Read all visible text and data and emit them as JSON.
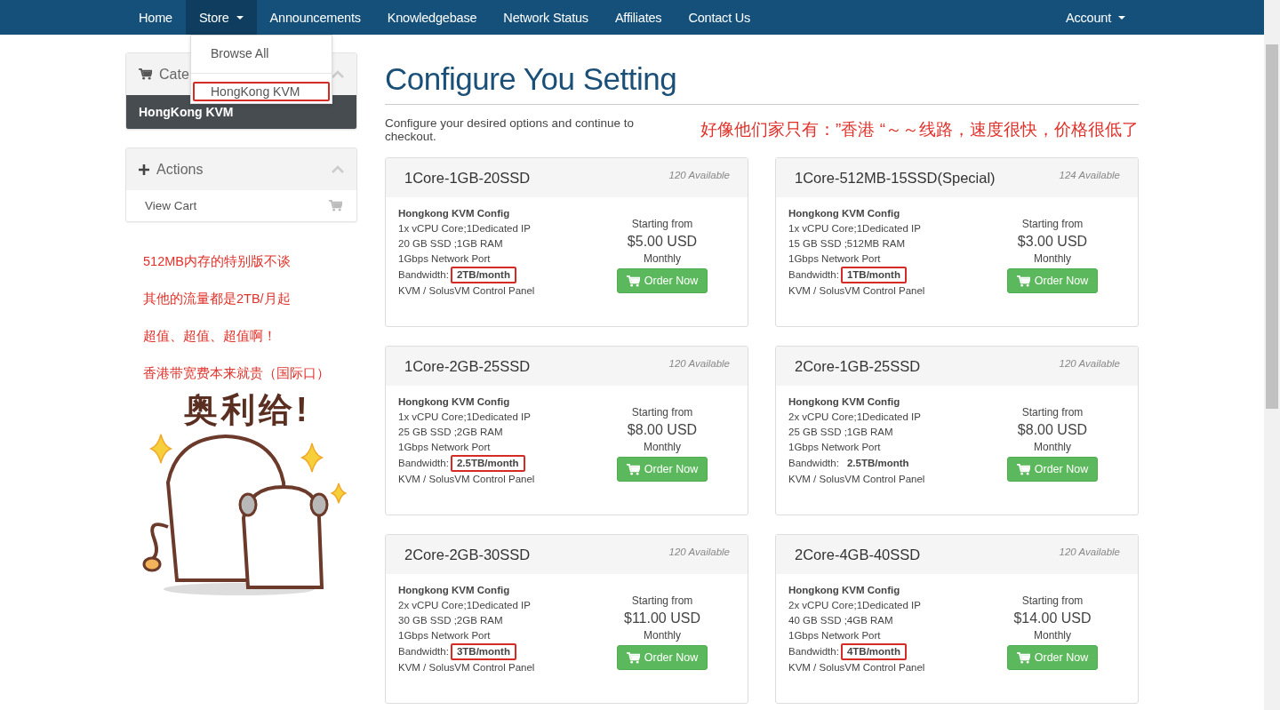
{
  "navbar": {
    "items": [
      {
        "label": "Home",
        "dropdown": false,
        "selected": false
      },
      {
        "label": "Store",
        "dropdown": true,
        "selected": true
      },
      {
        "label": "Announcements",
        "dropdown": false,
        "selected": false
      },
      {
        "label": "Knowledgebase",
        "dropdown": false,
        "selected": false
      },
      {
        "label": "Network Status",
        "dropdown": false,
        "selected": false
      },
      {
        "label": "Affiliates",
        "dropdown": false,
        "selected": false
      },
      {
        "label": "Contact Us",
        "dropdown": false,
        "selected": false
      }
    ],
    "account": {
      "label": "Account",
      "dropdown": true
    }
  },
  "store_menu": {
    "items": [
      {
        "label": "Browse All",
        "annotated": false
      },
      {
        "label": "HongKong KVM",
        "annotated": true
      }
    ]
  },
  "sidebar": {
    "categories": {
      "title": "Cate",
      "items": [
        {
          "label": "HongKong KVM",
          "selected": true
        }
      ]
    },
    "actions": {
      "title": "Actions",
      "items": [
        {
          "label": "View Cart"
        }
      ]
    },
    "notes": [
      "512MB内存的特别版不谈",
      "其他的流量都是2TB/月起",
      "超值、超值、超值啊！",
      "香港带宽费本来就贵（国际口）"
    ],
    "sticker": {
      "caption": "奥利给!"
    }
  },
  "main": {
    "title": "Configure You Setting",
    "subtitle": "Configure your desired options and continue to checkout.",
    "note": "好像他们家只有：”香港 “～～线路，速度很快，价格很低了",
    "products": [
      {
        "name": "1Core-1GB-20SSD",
        "available": "120 Available",
        "config": "Hongkong KVM Config",
        "features": [
          "1x vCPU Core;1Dedicated IP",
          "20 GB SSD ;1GB RAM",
          "1Gbps Network Port"
        ],
        "bandwidth_label": "Bandwidth:",
        "bandwidth": "2TB/month",
        "highlighted": true,
        "panel": "KVM / SolusVM Control Panel",
        "price_label": "Starting from",
        "price": "$5.00 USD",
        "cycle": "Monthly",
        "button": "Order Now"
      },
      {
        "name": "1Core-512MB-15SSD(Special)",
        "available": "124 Available",
        "config": "Hongkong KVM Config",
        "features": [
          "1x vCPU Core;1Dedicated IP",
          "15 GB SSD ;512MB RAM",
          "1Gbps Network Port"
        ],
        "bandwidth_label": "Bandwidth:",
        "bandwidth": "1TB/month",
        "highlighted": true,
        "panel": "KVM / SolusVM Control Panel",
        "price_label": "Starting from",
        "price": "$3.00 USD",
        "cycle": "Monthly",
        "button": "Order Now"
      },
      {
        "name": "1Core-2GB-25SSD",
        "available": "120 Available",
        "config": "Hongkong KVM Config",
        "features": [
          "1x vCPU Core;1Dedicated IP",
          "25 GB SSD ;2GB RAM",
          "1Gbps Network Port"
        ],
        "bandwidth_label": "Bandwidth:",
        "bandwidth": "2.5TB/month",
        "highlighted": true,
        "panel": "KVM / SolusVM Control Panel",
        "price_label": "Starting from",
        "price": "$8.00 USD",
        "cycle": "Monthly",
        "button": "Order Now"
      },
      {
        "name": "2Core-1GB-25SSD",
        "available": "120 Available",
        "config": "Hongkong KVM Config",
        "features": [
          "2x vCPU Core;1Dedicated IP",
          "25 GB SSD ;1GB RAM",
          "1Gbps Network Port"
        ],
        "bandwidth_label": "Bandwidth:",
        "bandwidth": "2.5TB/month",
        "highlighted": false,
        "panel": "KVM / SolusVM Control Panel",
        "price_label": "Starting from",
        "price": "$8.00 USD",
        "cycle": "Monthly",
        "button": "Order Now"
      },
      {
        "name": "2Core-2GB-30SSD",
        "available": "120 Available",
        "config": "Hongkong KVM Config",
        "features": [
          "2x vCPU Core;1Dedicated IP",
          "30 GB SSD ;2GB RAM",
          "1Gbps Network Port"
        ],
        "bandwidth_label": "Bandwidth:",
        "bandwidth": "3TB/month",
        "highlighted": true,
        "panel": "KVM / SolusVM Control Panel",
        "price_label": "Starting from",
        "price": "$11.00 USD",
        "cycle": "Monthly",
        "button": "Order Now"
      },
      {
        "name": "2Core-4GB-40SSD",
        "available": "120 Available",
        "config": "Hongkong KVM Config",
        "features": [
          "2x vCPU Core;1Dedicated IP",
          "40 GB SSD ;4GB RAM",
          "1Gbps Network Port"
        ],
        "bandwidth_label": "Bandwidth:",
        "bandwidth": "4TB/month",
        "highlighted": true,
        "panel": "KVM / SolusVM Control Panel",
        "price_label": "Starting from",
        "price": "$14.00 USD",
        "cycle": "Monthly",
        "button": "Order Now"
      }
    ]
  }
}
